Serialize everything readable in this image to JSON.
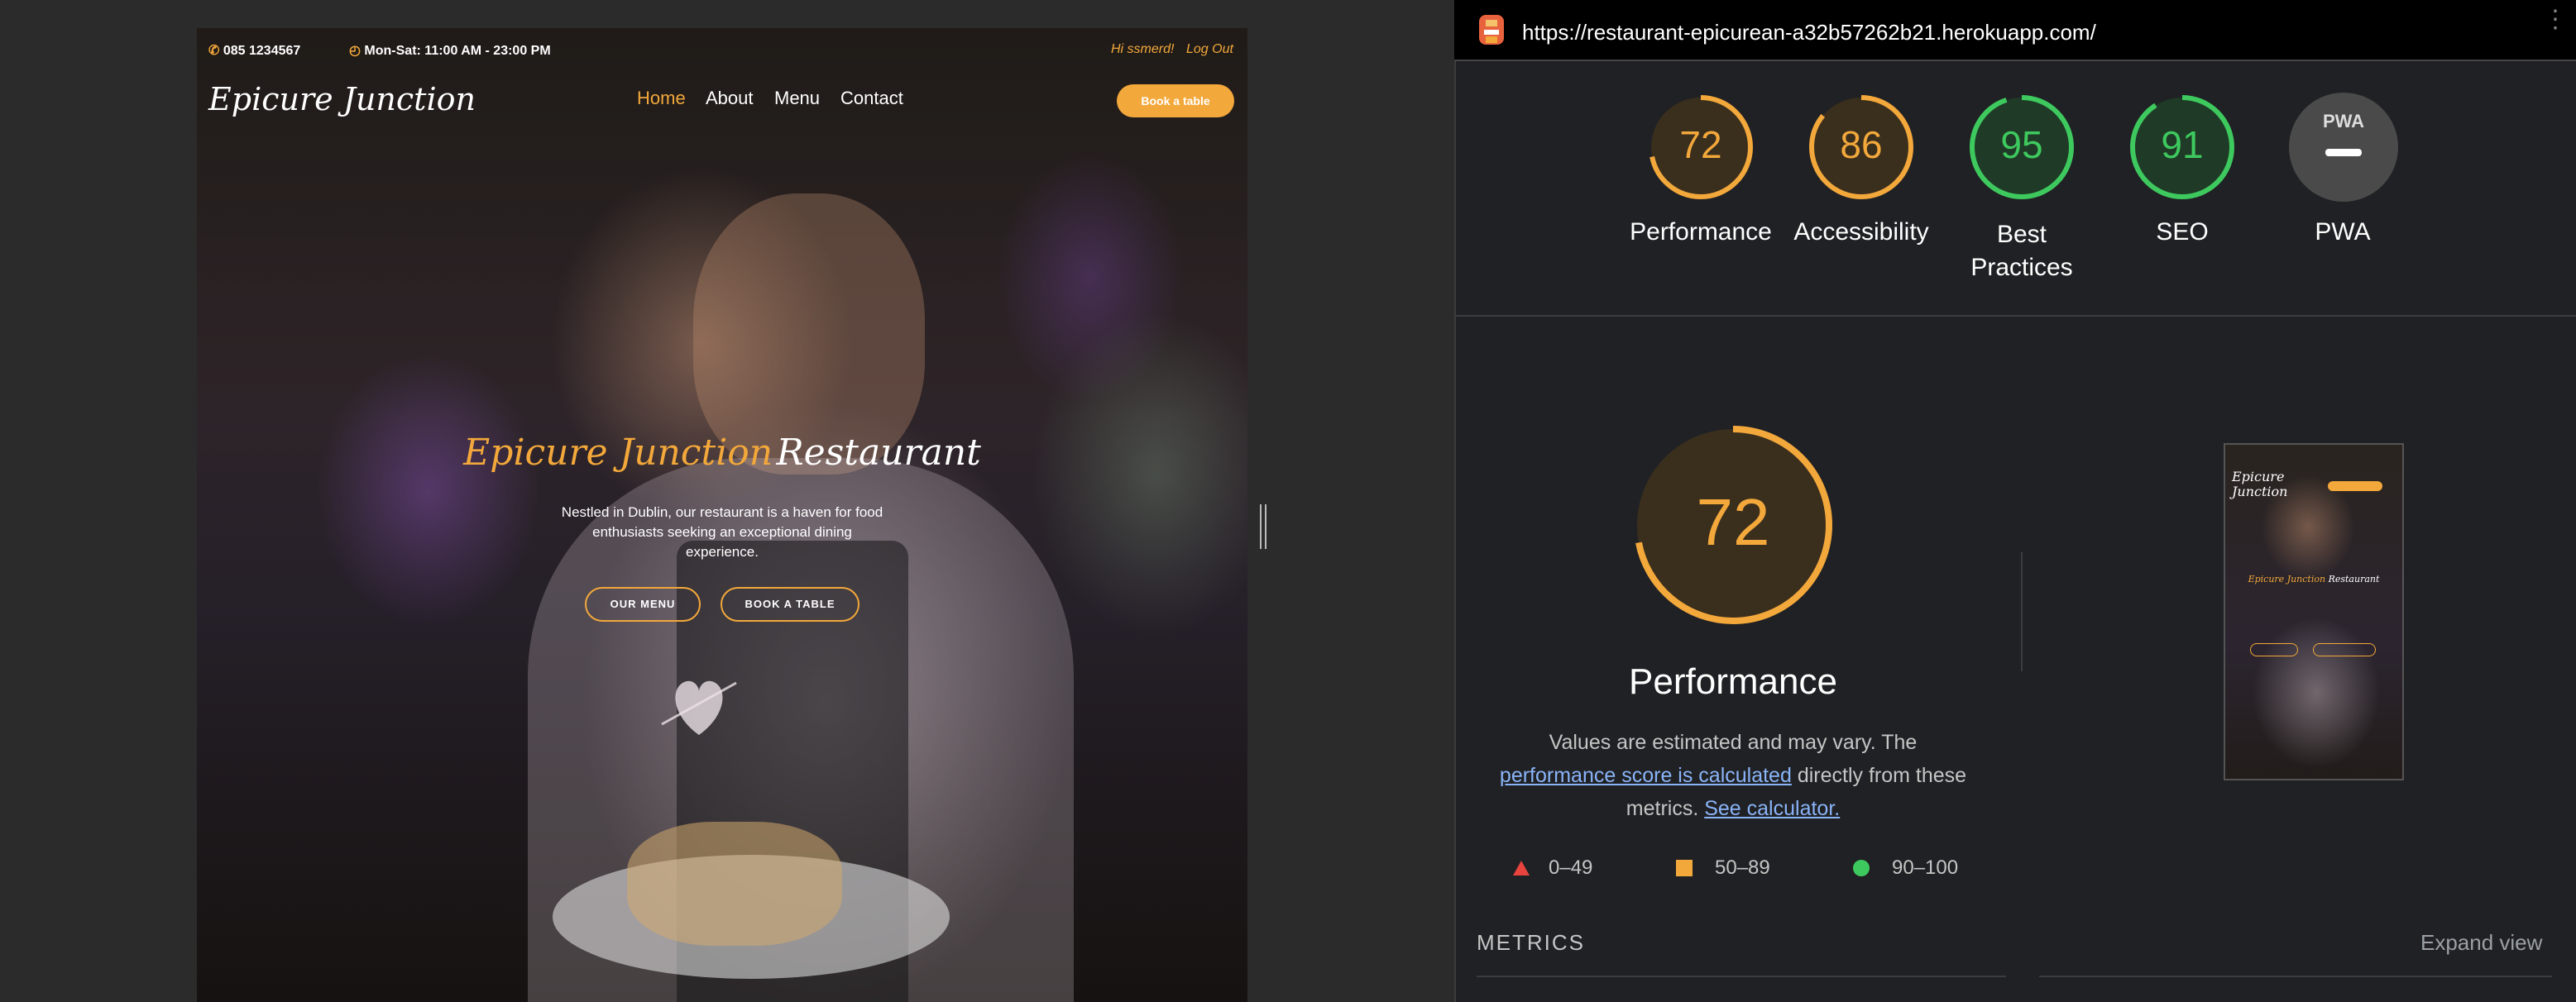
{
  "site": {
    "topbar": {
      "phone": "085 1234567",
      "hours": "Mon-Sat: 11:00 AM - 23:00 PM",
      "greeting": "Hi ssmerd!",
      "logout": "Log Out"
    },
    "logo": "Epicure Junction",
    "nav": [
      {
        "label": "Home",
        "active": true
      },
      {
        "label": "About",
        "active": false
      },
      {
        "label": "Menu",
        "active": false
      },
      {
        "label": "Contact",
        "active": false
      }
    ],
    "book_button": "Book a table",
    "hero": {
      "title_accent": "Epicure Junction",
      "title_rest": "Restaurant",
      "description_lines": [
        "Nestled in Dublin, our restaurant is a haven for food",
        "enthusiasts seeking an exceptional dining",
        "experience."
      ],
      "btn_menu": "OUR MENU",
      "btn_book": "BOOK A TABLE"
    }
  },
  "lighthouse": {
    "url": "https://restaurant-epicurean-a32b57262b21.herokuapp.com/",
    "scores": [
      {
        "label": "Performance",
        "value": 72,
        "color": "#f3a83b"
      },
      {
        "label": "Accessibility",
        "value": 86,
        "color": "#f3a83b"
      },
      {
        "label_line1": "Best",
        "label_line2": "Practices",
        "value": 95,
        "color": "#3ec95e"
      },
      {
        "label": "SEO",
        "value": 91,
        "color": "#3ec95e"
      },
      {
        "label": "PWA",
        "badge": "PWA"
      }
    ],
    "main": {
      "value": 72,
      "label": "Performance",
      "desc_text1": "Values are estimated and may vary. The",
      "desc_link1": "performance score is calculated",
      "desc_text2": "directly from these metrics.",
      "desc_link2": "See calculator."
    },
    "legend": [
      {
        "range": "0–49",
        "color": "#e8433d",
        "shape": "triangle"
      },
      {
        "range": "50–89",
        "color": "#f3a83b",
        "shape": "square"
      },
      {
        "range": "90–100",
        "color": "#3ec95e",
        "shape": "circle"
      }
    ],
    "metrics_header": "METRICS",
    "expand_view": "Expand view"
  }
}
